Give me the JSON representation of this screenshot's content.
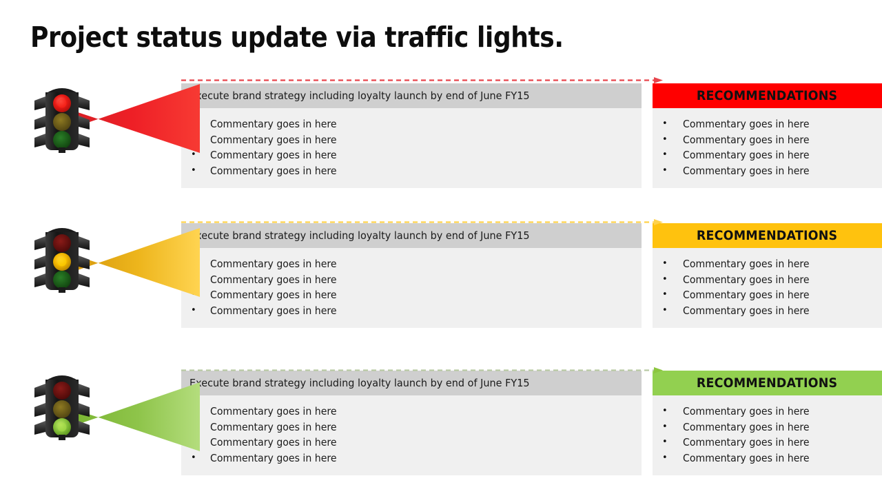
{
  "slide": {
    "title": "Project status update via traffic lights."
  },
  "bullet_glyph": "•",
  "rows": [
    {
      "id": "red",
      "status_label": "red",
      "lit_lamp": "red",
      "header": "Execute brand strategy including loyalty launch by end of  June FY15",
      "bullets": [
        "Commentary goes in here",
        "Commentary goes in here",
        "Commentary goes in here",
        "Commentary goes in here"
      ],
      "recommendations_title": "RECOMMENDATIONS",
      "recommendations": [
        "Commentary goes in here",
        "Commentary goes in here",
        "Commentary goes in here",
        "Commentary goes in here"
      ],
      "colors": {
        "banner": "#FF0000",
        "beam": "#E8202A",
        "connector": "#E8444C",
        "lamp": "#E81C1C"
      }
    },
    {
      "id": "amber",
      "status_label": "amber",
      "lit_lamp": "amber",
      "header": "Execute brand strategy including loyalty launch by end of  June FY15",
      "bullets": [
        "Commentary goes in here",
        "Commentary goes in here",
        "Commentary goes in here",
        "Commentary goes in here"
      ],
      "recommendations_title": "RECOMMENDATIONS",
      "recommendations": [
        "Commentary goes in here",
        "Commentary goes in here",
        "Commentary goes in here",
        "Commentary goes in here"
      ],
      "colors": {
        "banner": "#FFC20E",
        "beam": "#E8A317",
        "connector": "#FFD24A",
        "lamp": "#F5B800"
      }
    },
    {
      "id": "green",
      "status_label": "green",
      "lit_lamp": "green",
      "header": "Execute brand strategy including loyalty launch by end of  June FY15",
      "bullets": [
        "Commentary goes in here",
        "Commentary goes in here",
        "Commentary goes in here",
        "Commentary goes in here"
      ],
      "recommendations_title": "RECOMMENDATIONS",
      "recommendations": [
        "Commentary goes in here",
        "Commentary goes in here",
        "Commentary goes in here",
        "Commentary goes in here"
      ],
      "colors": {
        "banner": "#92D050",
        "beam": "#8CC63F",
        "connector": "#B9C9A4",
        "lamp": "#A3D93C"
      }
    }
  ]
}
